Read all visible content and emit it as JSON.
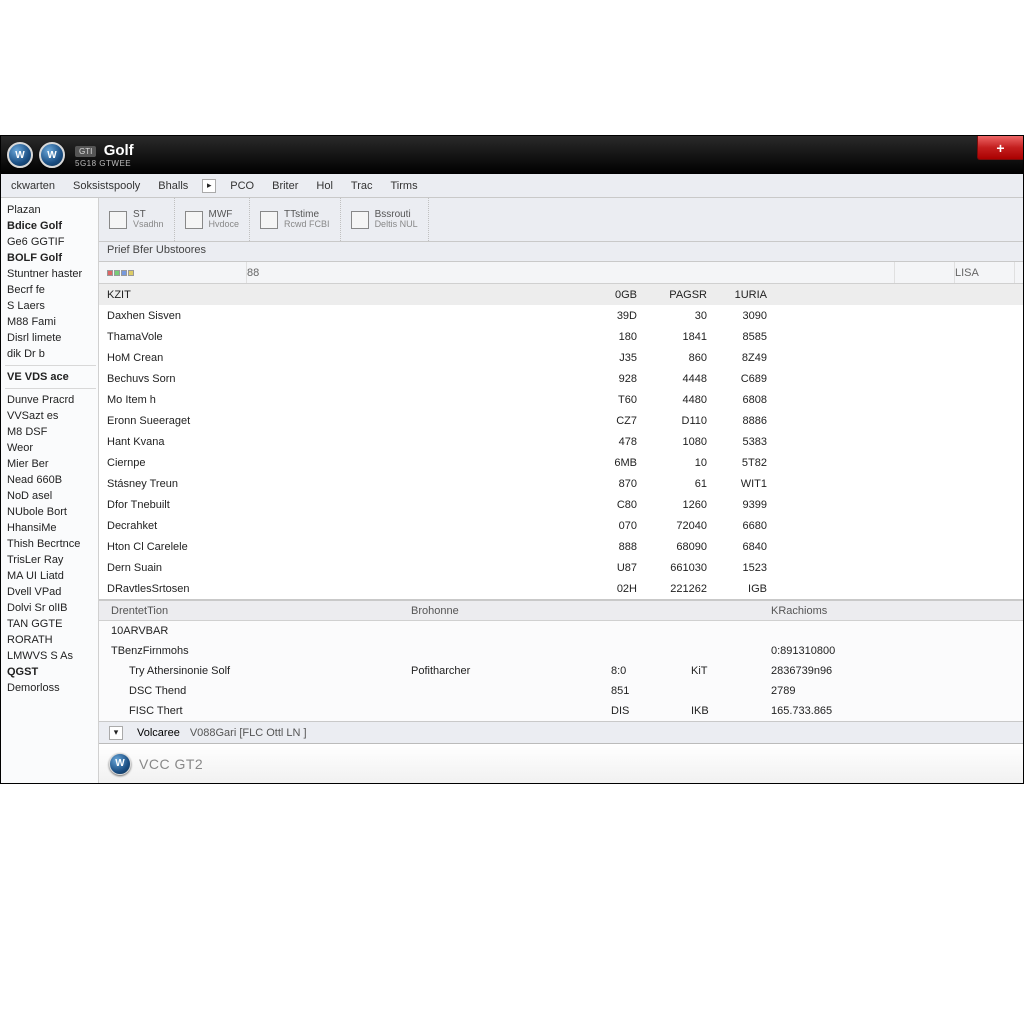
{
  "titlebar": {
    "badge": "GTI",
    "title": "Golf",
    "subtitle": "5G18 GTWEE",
    "close_glyph": "+"
  },
  "menubar": {
    "items": [
      "ckwarten",
      "Soksistspooly",
      "Bhalls",
      "PCO",
      "Briter",
      "Hol",
      "Trac",
      "Tirms"
    ]
  },
  "toolbar": {
    "groups": [
      {
        "top": "ST",
        "bottom": "Vsadhn"
      },
      {
        "top": "MWF",
        "bottom": "Hvdoce"
      },
      {
        "top": "TTstime",
        "bottom": "Rcwd FCBI"
      },
      {
        "top": "Bssrouti",
        "bottom": "Deltis  NUL"
      }
    ]
  },
  "breadcrumb": "Prief Bfer  Ubstoores",
  "grid": {
    "headers": {
      "a": "⬛⬛⬛⬛",
      "b": "88",
      "c": "",
      "d": "LISA"
    },
    "rows": [
      {
        "a": "KZIT",
        "b": "0GB",
        "c": "PAGSR",
        "d": "1URIA",
        "hl": true
      },
      {
        "a": "Daxhen Sisven",
        "b": "39D",
        "c": "30",
        "d": "3090"
      },
      {
        "a": "ThamaVole",
        "b": "180",
        "c": "1841",
        "d": "8585"
      },
      {
        "a": "HoM Crean",
        "b": "J35",
        "c": "860",
        "d": "8Z49"
      },
      {
        "a": "Bechuvs Sorn",
        "b": "928",
        "c": "4448",
        "d": "C689"
      },
      {
        "a": "Mo Item h",
        "b": "T60",
        "c": "4480",
        "d": "6808"
      },
      {
        "a": "Eronn Sueeraget",
        "b": "CZ7",
        "c": "D110",
        "d": "8886"
      },
      {
        "a": "Hant Kvana",
        "b": "478",
        "c": "1080",
        "d": "5383"
      },
      {
        "a": "Ciernpe",
        "b": "6MB",
        "c": "10",
        "d": "5T82"
      },
      {
        "a": "Stásney Treun",
        "b": "870",
        "c": "61",
        "d": "WIT1"
      },
      {
        "a": "Dfor Tnebuilt",
        "b": "C80",
        "c": "1260",
        "d": "9399"
      },
      {
        "a": "Decrahket",
        "b": "070",
        "c": "72040",
        "d": "6680"
      },
      {
        "a": "Hton Cl Carelele",
        "b": "888",
        "c": "68090",
        "d": "6840"
      },
      {
        "a": "Dern Suain",
        "b": "U87",
        "c": "661030",
        "d": "1523"
      },
      {
        "a": "DRavtlesSrtosen",
        "b": "02H",
        "c": "221262",
        "d": "IGB"
      }
    ]
  },
  "bottom": {
    "headers": [
      "DrentetTion",
      "Brohonne",
      "",
      "",
      "KRachioms"
    ],
    "section1": {
      "a": "10ARVBAR",
      "e": ""
    },
    "section2": {
      "a": "TBenzFirnmohs",
      "e": "0:891310800"
    },
    "rows": [
      {
        "a": "Try Athersinonie Solf",
        "b": "Pofitharcher",
        "c": "8:0",
        "d": "KiT",
        "e": "2836739n96"
      },
      {
        "a": "DSC Thend",
        "b": "",
        "c": "851",
        "d": "",
        "e": "2789"
      },
      {
        "a": "FISC Thert",
        "b": "",
        "c": "DIS",
        "d": "IKB",
        "e": "165.733.865"
      }
    ]
  },
  "sidebar": {
    "items": [
      {
        "t": "Plazan"
      },
      {
        "t": "Bdice Golf",
        "b": true
      },
      {
        "t": "Ge6 GGTIF"
      },
      {
        "t": "BOLF Golf",
        "b": true
      },
      {
        "t": "Stuntner haster"
      },
      {
        "t": "Becrf fe"
      },
      {
        "t": "S Laers"
      },
      {
        "t": "M88 Fami"
      },
      {
        "t": "Disrl limete"
      },
      {
        "t": "dik Dr b"
      },
      {
        "sep": true
      },
      {
        "t": "VE VDS ace",
        "b": true
      },
      {
        "sep": true
      },
      {
        "t": "Dunve Pracrd"
      },
      {
        "t": "VVSazt es"
      },
      {
        "t": "M8 DSF"
      },
      {
        "t": "Weor"
      },
      {
        "t": "Mier Ber"
      },
      {
        "t": "Nead 660B"
      },
      {
        "t": "NoD asel"
      },
      {
        "t": "NUbole Bort"
      },
      {
        "t": "HhansiMe"
      },
      {
        "t": "Thish Becrtnce"
      },
      {
        "t": "TrisLer Ray"
      },
      {
        "t": "MA UI Liatd"
      },
      {
        "t": "Dvell VPad"
      },
      {
        "t": "Dolvi Sr olIB"
      },
      {
        "t": "TAN GGTE"
      },
      {
        "t": "RORATH"
      },
      {
        "t": "LMWVS S As"
      },
      {
        "t": "QGST",
        "b": true
      },
      {
        "t": "Demorloss"
      }
    ]
  },
  "statusbar": {
    "items": [
      "Volcaree",
      "V088Gari  [FLC Ottl  LN ]"
    ]
  },
  "footer": {
    "text": "VCC GT2"
  }
}
